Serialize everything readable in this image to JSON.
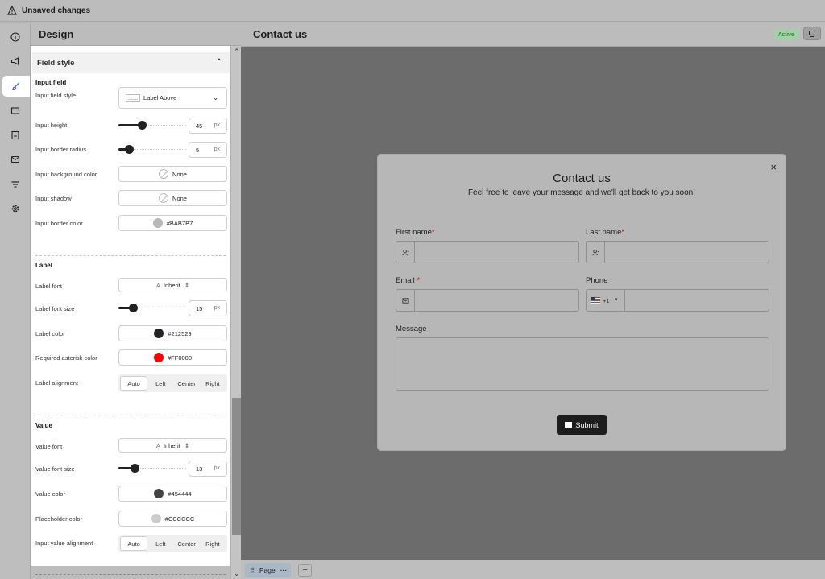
{
  "topbar": {
    "status": "Unsaved changes"
  },
  "panel": {
    "title": "Design",
    "section": "Field style",
    "input_field": {
      "heading": "Input field",
      "style_label": "Input field style",
      "style_value": "Label Above",
      "height_label": "Input height",
      "height_value": "45",
      "height_fraction": 0.35,
      "radius_label": "Input border radius",
      "radius_value": "5",
      "radius_fraction": 0.16,
      "bg_label": "Input background color",
      "bg_value": "None",
      "shadow_label": "Input shadow",
      "shadow_value": "None",
      "border_label": "Input border color",
      "border_value": "#BAB7B7",
      "unit": "px"
    },
    "label_group": {
      "heading": "Label",
      "font_label": "Label font",
      "font_value": "Inherit",
      "size_label": "Label font size",
      "size_value": "15",
      "size_fraction": 0.21,
      "color_label": "Label color",
      "color_value": "#212529",
      "asterisk_label": "Required asterisk color",
      "asterisk_value": "#FF0000",
      "align_label": "Label alignment",
      "align_options": [
        "Auto",
        "Left",
        "Center",
        "Right"
      ]
    },
    "value_group": {
      "heading": "Value",
      "font_label": "Value font",
      "font_value": "Inherit",
      "size_label": "Value font size",
      "size_value": "13",
      "size_fraction": 0.24,
      "color_label": "Value color",
      "color_value": "#454444",
      "placeholder_label": "Placeholder color",
      "placeholder_value": "#CCCCCC",
      "align_label": "Input value alignment",
      "align_options": [
        "Auto",
        "Left",
        "Center",
        "Right"
      ]
    }
  },
  "canvas": {
    "title": "Contact us",
    "status_badge": "Active",
    "form": {
      "title": "Contact us",
      "subtitle": "Feel free to leave your message and we'll get back to you soon!",
      "first_name": "First name",
      "last_name": "Last name",
      "email": "Email",
      "phone": "Phone",
      "phone_code": "+1",
      "message": "Message",
      "required_mark": "*",
      "submit": "Submit",
      "close": "×"
    },
    "footer": {
      "page_tab": "Page",
      "more": "···",
      "add": "+"
    }
  },
  "colors": {
    "swatch_border": "#BAB7B7",
    "swatch_label": "#212529",
    "swatch_asterisk": "#FF0000",
    "swatch_value": "#454444",
    "swatch_placeholder": "#CCCCCC",
    "badge_active": "#9fd3a3"
  },
  "icons": [
    "warning-icon",
    "info-icon",
    "megaphone-icon",
    "brush-icon",
    "layout-icon",
    "form-icon",
    "mail-icon",
    "filter-icon",
    "settings-icon",
    "chevron-up-icon",
    "chevron-down-icon",
    "close-icon",
    "user-icon",
    "envelope-icon",
    "device-icon"
  ]
}
